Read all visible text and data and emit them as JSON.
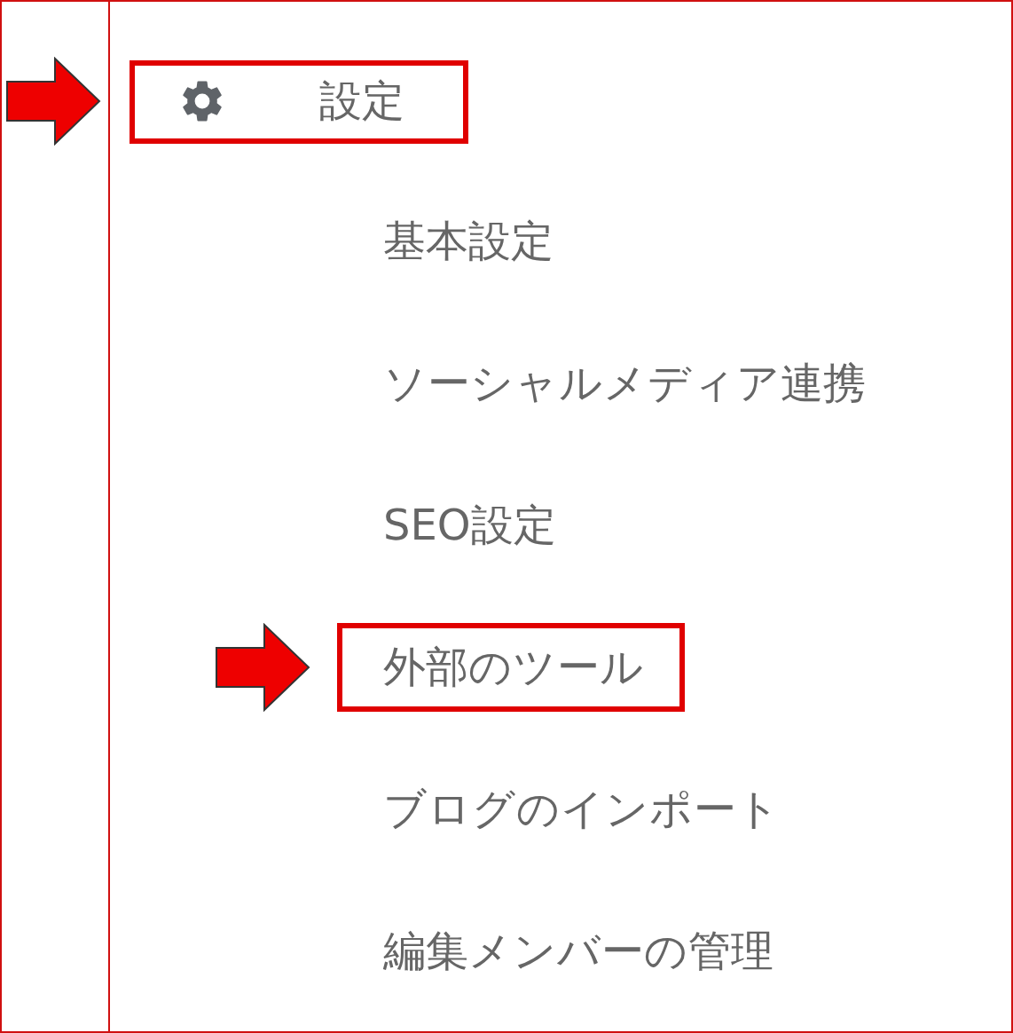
{
  "section": {
    "title": "設定",
    "highlighted": true
  },
  "items": [
    {
      "label": "基本設定",
      "highlighted": false
    },
    {
      "label": "ソーシャルメディア連携",
      "highlighted": false
    },
    {
      "label": "SEO設定",
      "highlighted": false
    },
    {
      "label": "外部のツール",
      "highlighted": true
    },
    {
      "label": "ブログのインポート",
      "highlighted": false
    },
    {
      "label": "編集メンバーの管理",
      "highlighted": false
    }
  ]
}
